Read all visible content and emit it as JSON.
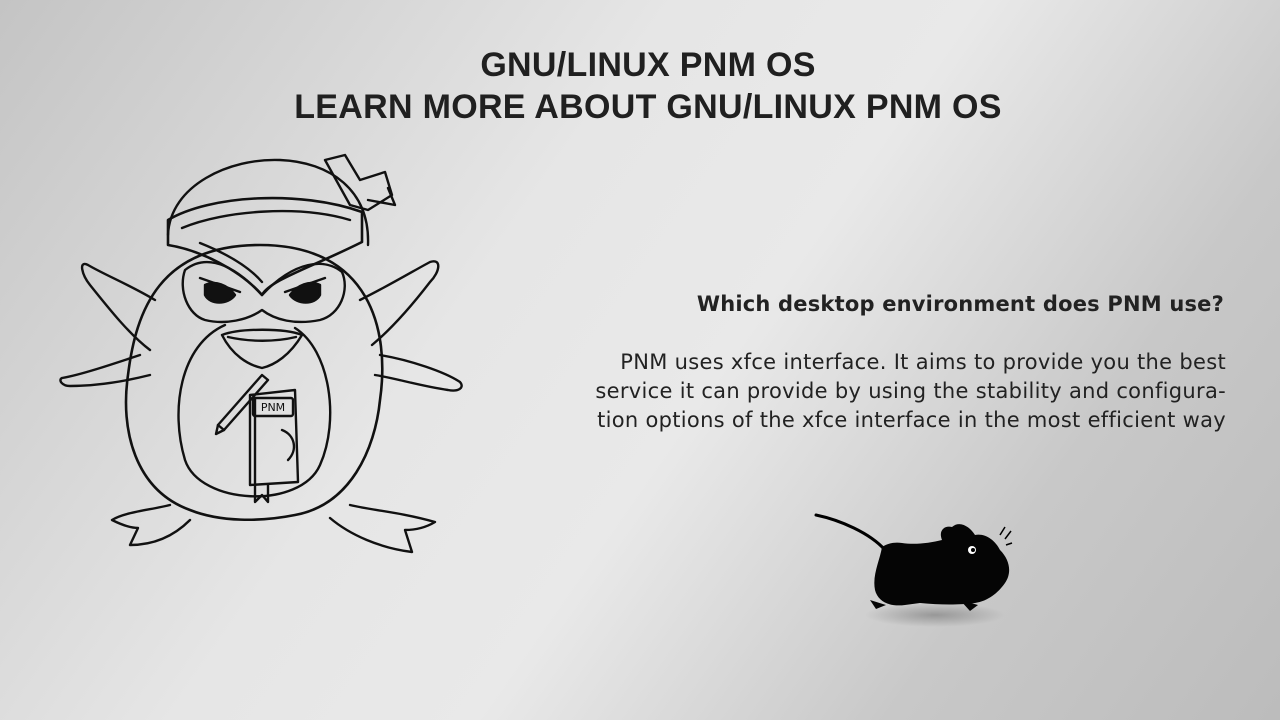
{
  "header": {
    "title_line1": "GNU/LINUX PNM OS",
    "title_line2": "LEARN MORE ABOUT GNU/LINUX PNM OS"
  },
  "faq": {
    "question": "Which desktop environment does PNM use?",
    "answer_lines": [
      "PNM uses xfce interface. It aims to provide you the best",
      "service it can provide by using the stability and configura-",
      "tion options of the xfce interface in the most efficient way"
    ]
  },
  "illustrations": {
    "penguin": {
      "icon": "ninja-penguin-icon",
      "badge_text": "PNM"
    },
    "mouse": {
      "icon": "xfce-mouse-icon"
    }
  },
  "colors": {
    "background_light": "#e8e8e8",
    "background_dark": "#bcbcbc",
    "text": "#1e1e1e"
  }
}
